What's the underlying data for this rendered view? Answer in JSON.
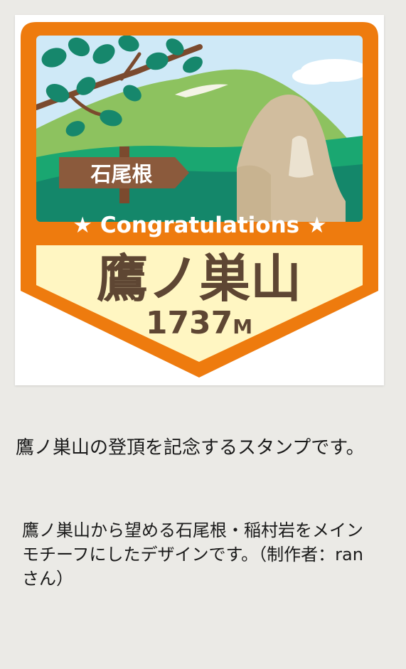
{
  "stamp": {
    "sign_text": "石尾根",
    "banner_text": "★ Congratulations ★",
    "mountain_name": "鷹ノ巣山",
    "elevation_number": "1737",
    "elevation_unit": "M",
    "colors": {
      "frame": "#ee7b0e",
      "sky": "#cfe9f7",
      "mountain": "#8dc25f",
      "leaves": "#16876c",
      "sign": "#8b5a3c",
      "rock": "#d1bd9e",
      "name_panel": "#fff6c2",
      "name_text": "#5e4633"
    }
  },
  "caption": "鷹ノ巣山の登頂を記念するスタンプです。",
  "description": "鷹ノ巣山から望める石尾根・稲村岩をメインモチーフにしたデザインです。（制作者：ranさん）"
}
